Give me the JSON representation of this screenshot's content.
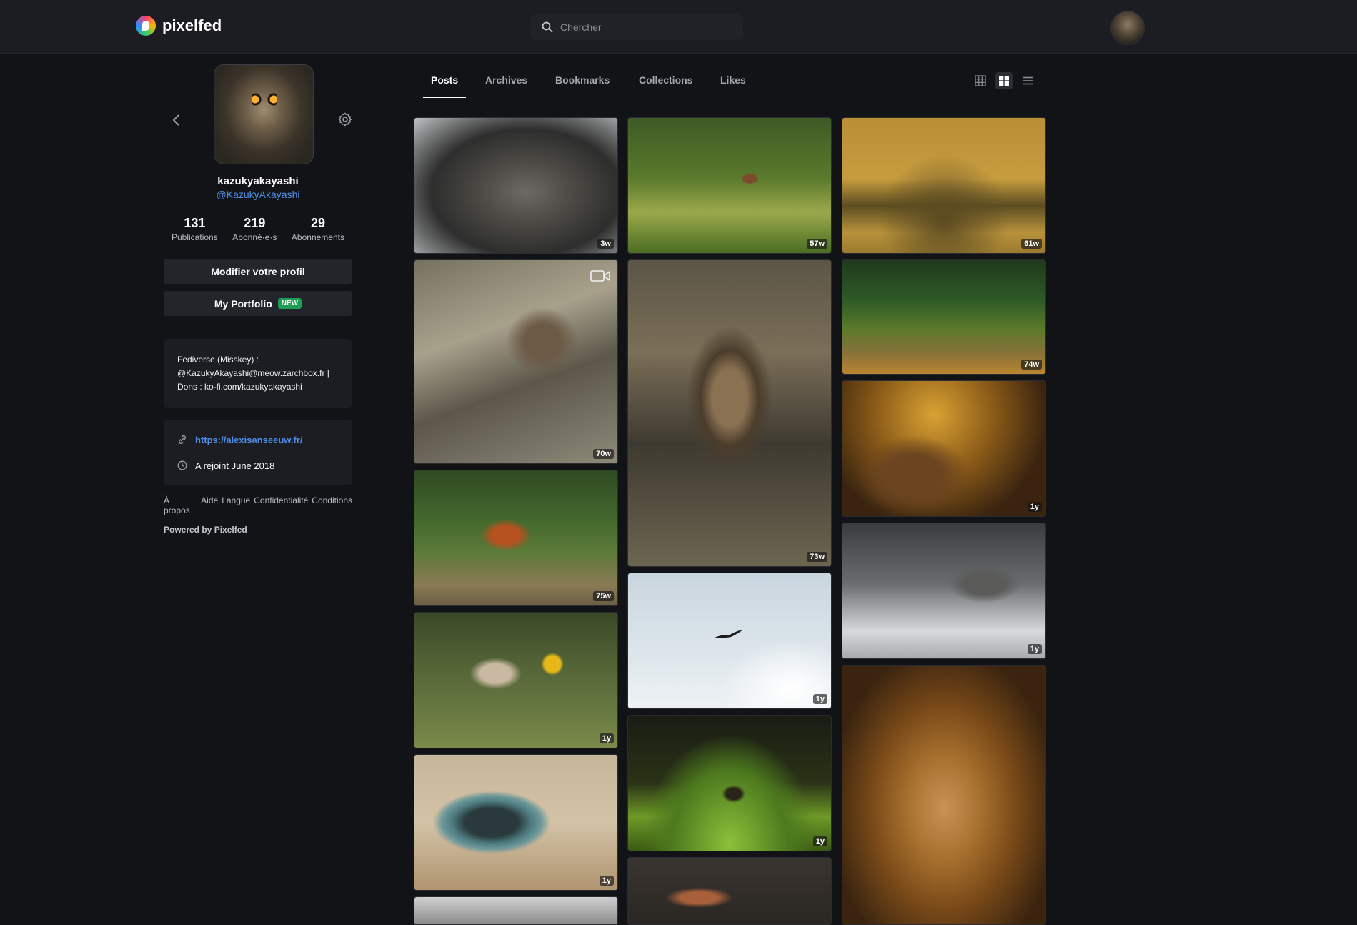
{
  "app": {
    "name": "pixelfed"
  },
  "search": {
    "placeholder": "Chercher"
  },
  "profile": {
    "username": "kazukyakayashi",
    "handle": "@KazukyAkayashi",
    "stats": [
      {
        "value": "131",
        "label": "Publications"
      },
      {
        "value": "219",
        "label": "Abonné·e·s"
      },
      {
        "value": "29",
        "label": "Abonnements"
      }
    ],
    "edit_button": "Modifier votre profil",
    "portfolio_button": "My Portfolio",
    "portfolio_badge": "NEW",
    "bio_lines": [
      "Fediverse (Misskey) :",
      "@KazukyAkayashi@meow.zarchbox.fr |",
      "Dons : ko-fi.com/kazukyakayashi"
    ],
    "website": "https://alexisanseeuw.fr/",
    "joined": "A rejoint June 2018"
  },
  "footer": {
    "links": [
      "À propos",
      "Aide",
      "Langue",
      "Confidentialité",
      "Conditions"
    ],
    "powered": "Powered by Pixelfed"
  },
  "tabs": [
    {
      "label": "Posts",
      "active": true
    },
    {
      "label": "Archives",
      "active": false
    },
    {
      "label": "Bookmarks",
      "active": false
    },
    {
      "label": "Collections",
      "active": false
    },
    {
      "label": "Likes",
      "active": false
    }
  ],
  "view_modes": [
    "grid-small-icon",
    "grid-large-icon",
    "list-icon"
  ],
  "posts": {
    "col1": [
      {
        "subject": "cat lying on blanket",
        "age": "3w"
      },
      {
        "subject": "owl in branches",
        "age": "70w",
        "video": true
      },
      {
        "subject": "red fox in grass",
        "age": "75w"
      },
      {
        "subject": "kitten with yellow flowers",
        "age": "1y"
      },
      {
        "subject": "cat sleeping in clay pot",
        "age": "1y"
      }
    ],
    "col2": [
      {
        "subject": "squirrel in meadow",
        "age": "57w"
      },
      {
        "subject": "long-eared owl on branch",
        "age": "73w"
      },
      {
        "subject": "bird in sky",
        "age": "1y"
      },
      {
        "subject": "jumping spider on leaf",
        "age": "1y"
      }
    ],
    "col3": [
      {
        "subject": "golden field",
        "age": "61w"
      },
      {
        "subject": "green meadow",
        "age": "74w"
      },
      {
        "subject": "insect on log",
        "age": "1y"
      },
      {
        "subject": "cat in snow",
        "age": "1y"
      },
      {
        "subject": "lion portrait"
      }
    ]
  },
  "colors": {
    "accent_link": "#4e8ee6",
    "badge_new": "#1f9d55",
    "background": "#111317",
    "panel": "#1b1d22"
  }
}
